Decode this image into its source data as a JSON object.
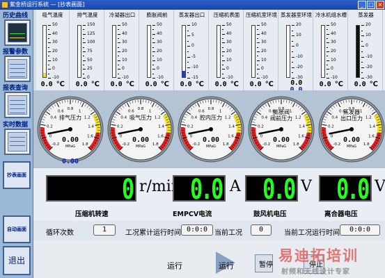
{
  "window": {
    "title": "紫金桥运行系统 — [抄表画面]"
  },
  "sidebar": {
    "items": [
      {
        "label": "历史曲线"
      },
      {
        "label": "报警参数"
      },
      {
        "label": "报表查询"
      },
      {
        "label": "实时数据"
      },
      {
        "label": "抄表画面"
      },
      {
        "label": "自动画面"
      },
      {
        "label": "退出"
      }
    ]
  },
  "thermometers": [
    {
      "label": "吸气温度",
      "ticks": [
        "50",
        "40",
        "30",
        "20",
        "10",
        "0",
        "-10"
      ],
      "value": "0.0",
      "unit": "℃",
      "fill_color": "#f0e020",
      "level": 0.08
    },
    {
      "label": "排气温度",
      "ticks": [
        "150",
        "125",
        "100",
        "75",
        "50",
        "25",
        "0"
      ],
      "value": "0.0",
      "unit": "℃",
      "fill_color": "#ffffff",
      "level": 0
    },
    {
      "label": "冷凝器出口",
      "ticks": [
        "50",
        "40",
        "30",
        "20",
        "10",
        "0",
        "-10"
      ],
      "value": "0.0",
      "unit": "℃",
      "fill_color": "#ffffff",
      "level": 0
    },
    {
      "label": "膨胀阀前",
      "ticks": [
        "50",
        "40",
        "30",
        "20",
        "10",
        "0",
        "-10"
      ],
      "value": "0.0",
      "unit": "℃",
      "fill_color": "#ffffff",
      "level": 0
    },
    {
      "label": "蒸发器出口",
      "ticks": [
        "10",
        "5",
        "0",
        "-5",
        "-10",
        "-15"
      ],
      "value": "0.0",
      "unit": "℃",
      "fill_color": "#2040c0",
      "level": 0.12
    },
    {
      "label": "压缩机表面",
      "ticks": [
        "50",
        "40",
        "30",
        "20",
        "10",
        "0",
        "-10"
      ],
      "value": "0.0",
      "unit": "℃",
      "fill_color": "#ffffff",
      "level": 0
    },
    {
      "label": "压缩机室环境",
      "ticks": [
        "50",
        "40",
        "30",
        "20",
        "10",
        "0",
        "-10"
      ],
      "value": "0.0",
      "unit": "℃",
      "fill_color": "#ffffff",
      "level": 0
    },
    {
      "label": "蒸发器室环境",
      "ticks": [
        "20",
        "10",
        "0",
        "-10",
        "-20",
        "-30"
      ],
      "value": "0.0",
      "value2": "0.0",
      "unit": "",
      "fill_color": "#ffffff",
      "level": 0
    },
    {
      "label": "冷水机组水槽",
      "ticks": [
        "50",
        "40",
        "30",
        "20",
        "10",
        "0",
        "-10"
      ],
      "value": "0.0",
      "unit": "℃",
      "fill_color": "#ffffff",
      "level": 0
    },
    {
      "label": "蒸发器",
      "ticks": [
        "20",
        "10",
        "0",
        "-10",
        "-20",
        "-30"
      ],
      "value": "0.0",
      "unit": "℃",
      "fill_color": "#101010",
      "level": 1.0
    }
  ],
  "dials": [
    {
      "label1": "排气压力",
      "label2": "",
      "value": "0.00",
      "value2": "0.00",
      "unit": "MPaG",
      "scale": [
        "-0.2",
        "0",
        "0.2",
        "0.4",
        "0.6",
        "0.8",
        "1",
        "1.2",
        "1.4",
        "1.6",
        "1.8"
      ]
    },
    {
      "label1": "吸气压力",
      "label2": "",
      "value": "0.00",
      "value2": "",
      "unit": "MPaG",
      "scale": [
        "-0.2",
        "0",
        "0.2",
        "0.4",
        "0.6",
        "0.8",
        "1",
        "1.2",
        "1.4",
        "1.6",
        "1.8"
      ]
    },
    {
      "label1": "腔内压力",
      "label2": "",
      "value": "0.00",
      "value2": "",
      "unit": "MPaG",
      "scale": [
        "-0.2",
        "0",
        "0.2",
        "0.4",
        "0.6",
        "0.8",
        "1",
        "1.2",
        "1.4",
        "1.6",
        "1.8"
      ]
    },
    {
      "label1": "膨胀阀",
      "label2": "阀前压力",
      "value": "0.00",
      "value2": "",
      "unit": "MPaG",
      "scale": [
        "-0.2",
        "0",
        "0.2",
        "0.4",
        "0.6",
        "0.8",
        "1",
        "1.2",
        "1.4",
        "1.6",
        "1.8"
      ]
    },
    {
      "label1": "蒸发器",
      "label2": "出口压力",
      "value": "0.00",
      "value2": "",
      "unit": "MPaG",
      "scale": [
        "-0.2",
        "0",
        "0.2",
        "0.4",
        "0.6",
        "0.8",
        "1",
        "1.2",
        "1.4",
        "1.6",
        "1.8"
      ]
    }
  ],
  "digital": [
    {
      "label": "压缩机转速",
      "value": "0",
      "unit": "r/min"
    },
    {
      "label": "EMPCV电流",
      "value": "0.0",
      "unit": "A"
    },
    {
      "label": "鼓风机电压",
      "value": "0.0",
      "unit": "V"
    },
    {
      "label": "离合器电压",
      "value": "0.0",
      "unit": "V"
    }
  ],
  "bottom": {
    "cycle_label": "循环次数",
    "cycle_value": "1",
    "cum_label": "工况累计运行时间",
    "cum_value": "0:0:0",
    "cur_cond_label": "当前工况",
    "cur_cond_value": "0",
    "cur_time_label": "当前工况运行时间",
    "cur_time_value": "0:0:0"
  },
  "controls": {
    "run1": "运行",
    "run2": "运行",
    "pause": "暂停",
    "stop": "停止"
  },
  "watermark": {
    "line1": "易迪拓培训",
    "line2": "射频和天线设计专家"
  }
}
